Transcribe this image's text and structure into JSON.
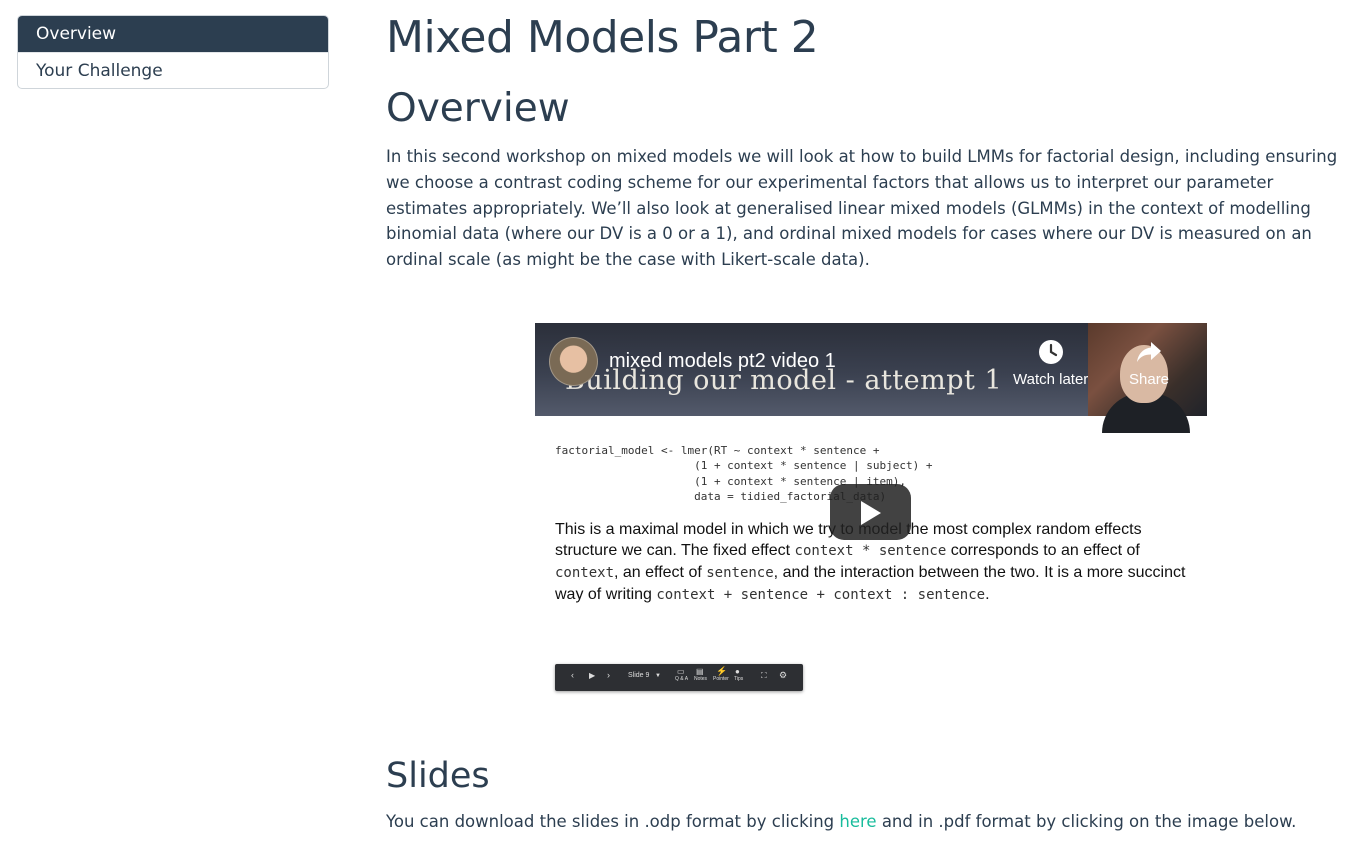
{
  "sidebar": {
    "items": [
      {
        "label": "Overview",
        "active": true
      },
      {
        "label": "Your Challenge",
        "active": false
      }
    ]
  },
  "page": {
    "title": "Mixed Models Part 2"
  },
  "overview": {
    "heading": "Overview",
    "paragraph": "In this second workshop on mixed models we will look at how to build LMMs for factorial design, including ensuring we choose a contrast coding scheme for our experimental factors that allows us to interpret our parameter estimates appropriately. We’ll also look at generalised linear mixed models (GLMMs) in the context of modelling binomial data (where our DV is a 0 or a 1), and ordinal mixed models for cases where our DV is measured on an ordinal scale (as might be the case with Likert-scale data)."
  },
  "video": {
    "title": "mixed models pt2 video 1",
    "watch_later_label": "Watch later",
    "share_label": "Share",
    "slide_heading": "Building our model - attempt 1",
    "code": "factorial_model <- lmer(RT ~ context * sentence +\n                     (1 + context * sentence | subject) +\n                     (1 + context * sentence | item),\n                     data = tidied_factorial_data)",
    "text": {
      "t1": "This is a maximal model in which we try to model the most complex random effects structure we can. The fixed effect ",
      "c1": "context * sentence",
      "t2": " corresponds to an effect of ",
      "c2": "context",
      "t3": ", an effect of ",
      "c3": "sentence",
      "t4": ", and the interaction between the two. It is a more succinct way of writing ",
      "c4": "context + sentence + context : sentence",
      "t5": "."
    },
    "toolbar": {
      "slide_label": "Slide 9",
      "qa": "Q & A",
      "notes": "Notes",
      "pointer": "Pointer",
      "tips": "Tips"
    },
    "colors": {
      "overlay": "#212121",
      "pointer_icon": "#e53935"
    }
  },
  "slides": {
    "heading": "Slides",
    "text_before": "You can download the slides in .odp format by clicking ",
    "link_text": "here",
    "text_after": " and in .pdf format by clicking on the image below."
  },
  "colors": {
    "text": "#2c3e50",
    "active_bg": "#2c3e50",
    "link": "#18bc9c"
  }
}
